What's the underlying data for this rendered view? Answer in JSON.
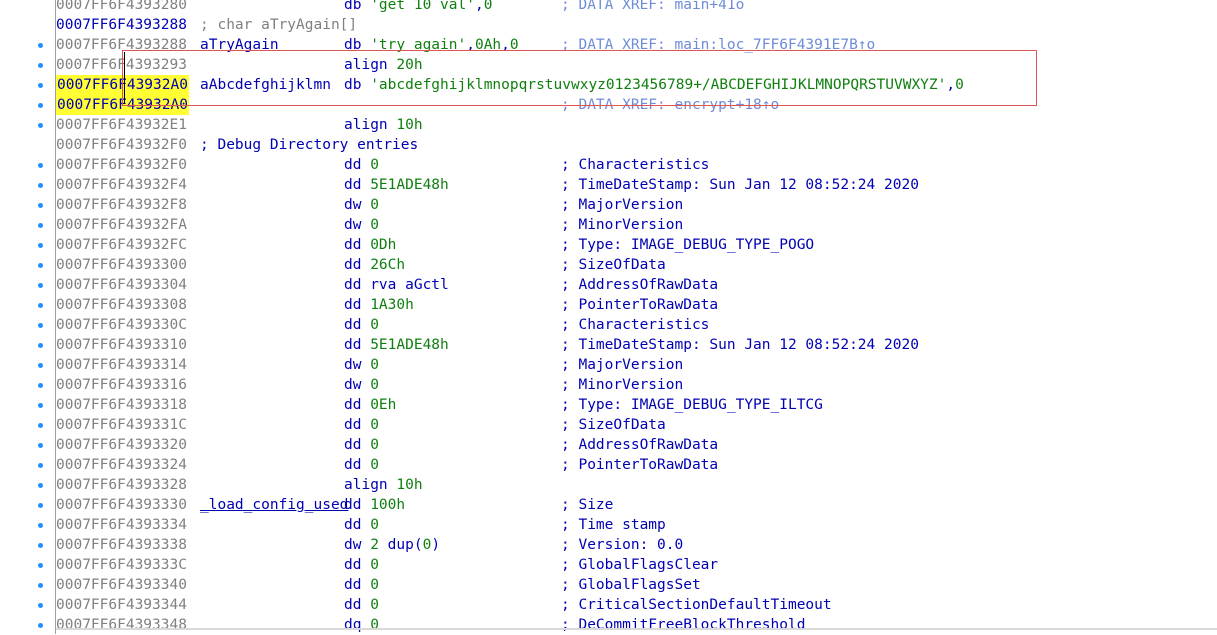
{
  "rows": [
    {
      "addr": "0007FF6F4393280",
      "addr_style": "grey",
      "label": "",
      "code": "db 'get 10 val',0",
      "comment": "; DATA XREF: main+41o",
      "comment_style": "light",
      "dot": false
    },
    {
      "addr": "0007FF6F4393288",
      "addr_style": "blue",
      "label": "",
      "code": "",
      "comment": "",
      "full_comment": "; char aTryAgain[]",
      "dot": false
    },
    {
      "addr": "0007FF6F4393288",
      "addr_style": "grey",
      "label": "aTryAgain",
      "code": "db 'try again',0Ah,0",
      "comment": "; DATA XREF: main:loc_7FF6F4391E7B↑o",
      "comment_style": "light",
      "dot": true
    },
    {
      "addr": "0007FF6F4393293",
      "addr_style": "grey",
      "label": "",
      "code": "align 20h",
      "comment": "",
      "dot": true
    },
    {
      "addr": "0007FF6F43932A0",
      "addr_style": "hl",
      "label": "aAbcdefghijklmn",
      "code": "db 'abcdefghijklmnopqrstuvwxyz0123456789+/ABCDEFGHIJKLMNOPQRSTUVWXYZ',0",
      "comment": "",
      "dot": true
    },
    {
      "addr": "0007FF6F43932A0",
      "addr_style": "hl",
      "label": "",
      "code": "",
      "comment": "; DATA XREF: encrypt+18↑o",
      "comment_style": "light",
      "dot": true
    },
    {
      "addr": "0007FF6F43932E1",
      "addr_style": "grey",
      "label": "",
      "code": "align 10h",
      "comment": "",
      "dot": true
    },
    {
      "addr": "0007FF6F43932F0",
      "addr_style": "grey",
      "label": "",
      "code": "",
      "comment": "",
      "full_comment": "; Debug Directory entries",
      "full_comment_style": "dark",
      "dot": false
    },
    {
      "addr": "0007FF6F43932F0",
      "addr_style": "grey",
      "label": "",
      "code": "dd 0",
      "comment": "; Characteristics",
      "comment_style": "dark",
      "dot": true
    },
    {
      "addr": "0007FF6F43932F4",
      "addr_style": "grey",
      "label": "",
      "code": "dd 5E1ADE48h",
      "comment": "; TimeDateStamp: Sun Jan 12 08:52:24 2020",
      "comment_style": "dark",
      "dot": true
    },
    {
      "addr": "0007FF6F43932F8",
      "addr_style": "grey",
      "label": "",
      "code": "dw 0",
      "comment": "; MajorVersion",
      "comment_style": "dark",
      "dot": true
    },
    {
      "addr": "0007FF6F43932FA",
      "addr_style": "grey",
      "label": "",
      "code": "dw 0",
      "comment": "; MinorVersion",
      "comment_style": "dark",
      "dot": true
    },
    {
      "addr": "0007FF6F43932FC",
      "addr_style": "grey",
      "label": "",
      "code": "dd 0Dh",
      "comment": "; Type: IMAGE_DEBUG_TYPE_POGO",
      "comment_style": "dark",
      "dot": true
    },
    {
      "addr": "0007FF6F4393300",
      "addr_style": "grey",
      "label": "",
      "code": "dd 26Ch",
      "comment": "; SizeOfData",
      "comment_style": "dark",
      "dot": true
    },
    {
      "addr": "0007FF6F4393304",
      "addr_style": "grey",
      "label": "",
      "code": "dd rva aGctl",
      "comment": "; AddressOfRawData",
      "comment_style": "dark",
      "dot": true
    },
    {
      "addr": "0007FF6F4393308",
      "addr_style": "grey",
      "label": "",
      "code": "dd 1A30h",
      "comment": "; PointerToRawData",
      "comment_style": "dark",
      "dot": true
    },
    {
      "addr": "0007FF6F439330C",
      "addr_style": "grey",
      "label": "",
      "code": "dd 0",
      "comment": "; Characteristics",
      "comment_style": "dark",
      "dot": true
    },
    {
      "addr": "0007FF6F4393310",
      "addr_style": "grey",
      "label": "",
      "code": "dd 5E1ADE48h",
      "comment": "; TimeDateStamp: Sun Jan 12 08:52:24 2020",
      "comment_style": "dark",
      "dot": true
    },
    {
      "addr": "0007FF6F4393314",
      "addr_style": "grey",
      "label": "",
      "code": "dw 0",
      "comment": "; MajorVersion",
      "comment_style": "dark",
      "dot": true
    },
    {
      "addr": "0007FF6F4393316",
      "addr_style": "grey",
      "label": "",
      "code": "dw 0",
      "comment": "; MinorVersion",
      "comment_style": "dark",
      "dot": true
    },
    {
      "addr": "0007FF6F4393318",
      "addr_style": "grey",
      "label": "",
      "code": "dd 0Eh",
      "comment": "; Type: IMAGE_DEBUG_TYPE_ILTCG",
      "comment_style": "dark",
      "dot": true
    },
    {
      "addr": "0007FF6F439331C",
      "addr_style": "grey",
      "label": "",
      "code": "dd 0",
      "comment": "; SizeOfData",
      "comment_style": "dark",
      "dot": true
    },
    {
      "addr": "0007FF6F4393320",
      "addr_style": "grey",
      "label": "",
      "code": "dd 0",
      "comment": "; AddressOfRawData",
      "comment_style": "dark",
      "dot": true
    },
    {
      "addr": "0007FF6F4393324",
      "addr_style": "grey",
      "label": "",
      "code": "dd 0",
      "comment": "; PointerToRawData",
      "comment_style": "dark",
      "dot": true
    },
    {
      "addr": "0007FF6F4393328",
      "addr_style": "grey",
      "label": "",
      "code": "align 10h",
      "comment": "",
      "dot": true
    },
    {
      "addr": "0007FF6F4393330",
      "addr_style": "grey",
      "label": "_load_config_used",
      "label_underline": true,
      "code": "dd 100h",
      "comment": "; Size",
      "comment_style": "dark",
      "dot": true
    },
    {
      "addr": "0007FF6F4393334",
      "addr_style": "grey",
      "label": "",
      "code": "dd 0",
      "comment": "; Time stamp",
      "comment_style": "dark",
      "dot": true
    },
    {
      "addr": "0007FF6F4393338",
      "addr_style": "grey",
      "label": "",
      "code": "dw 2 dup(0)",
      "comment": "; Version: 0.0",
      "comment_style": "dark",
      "dot": true
    },
    {
      "addr": "0007FF6F439333C",
      "addr_style": "grey",
      "label": "",
      "code": "dd 0",
      "comment": "; GlobalFlagsClear",
      "comment_style": "dark",
      "dot": true
    },
    {
      "addr": "0007FF6F4393340",
      "addr_style": "grey",
      "label": "",
      "code": "dd 0",
      "comment": "; GlobalFlagsSet",
      "comment_style": "dark",
      "dot": true
    },
    {
      "addr": "0007FF6F4393344",
      "addr_style": "grey",
      "label": "",
      "code": "dd 0",
      "comment": "; CriticalSectionDefaultTimeout",
      "comment_style": "dark",
      "dot": true
    },
    {
      "addr": "0007FF6F4393348",
      "addr_style": "grey",
      "label": "",
      "code": "dq 0",
      "comment": "; DeCommitFreeBlockThreshold",
      "comment_style": "dark",
      "dot": true
    }
  ]
}
